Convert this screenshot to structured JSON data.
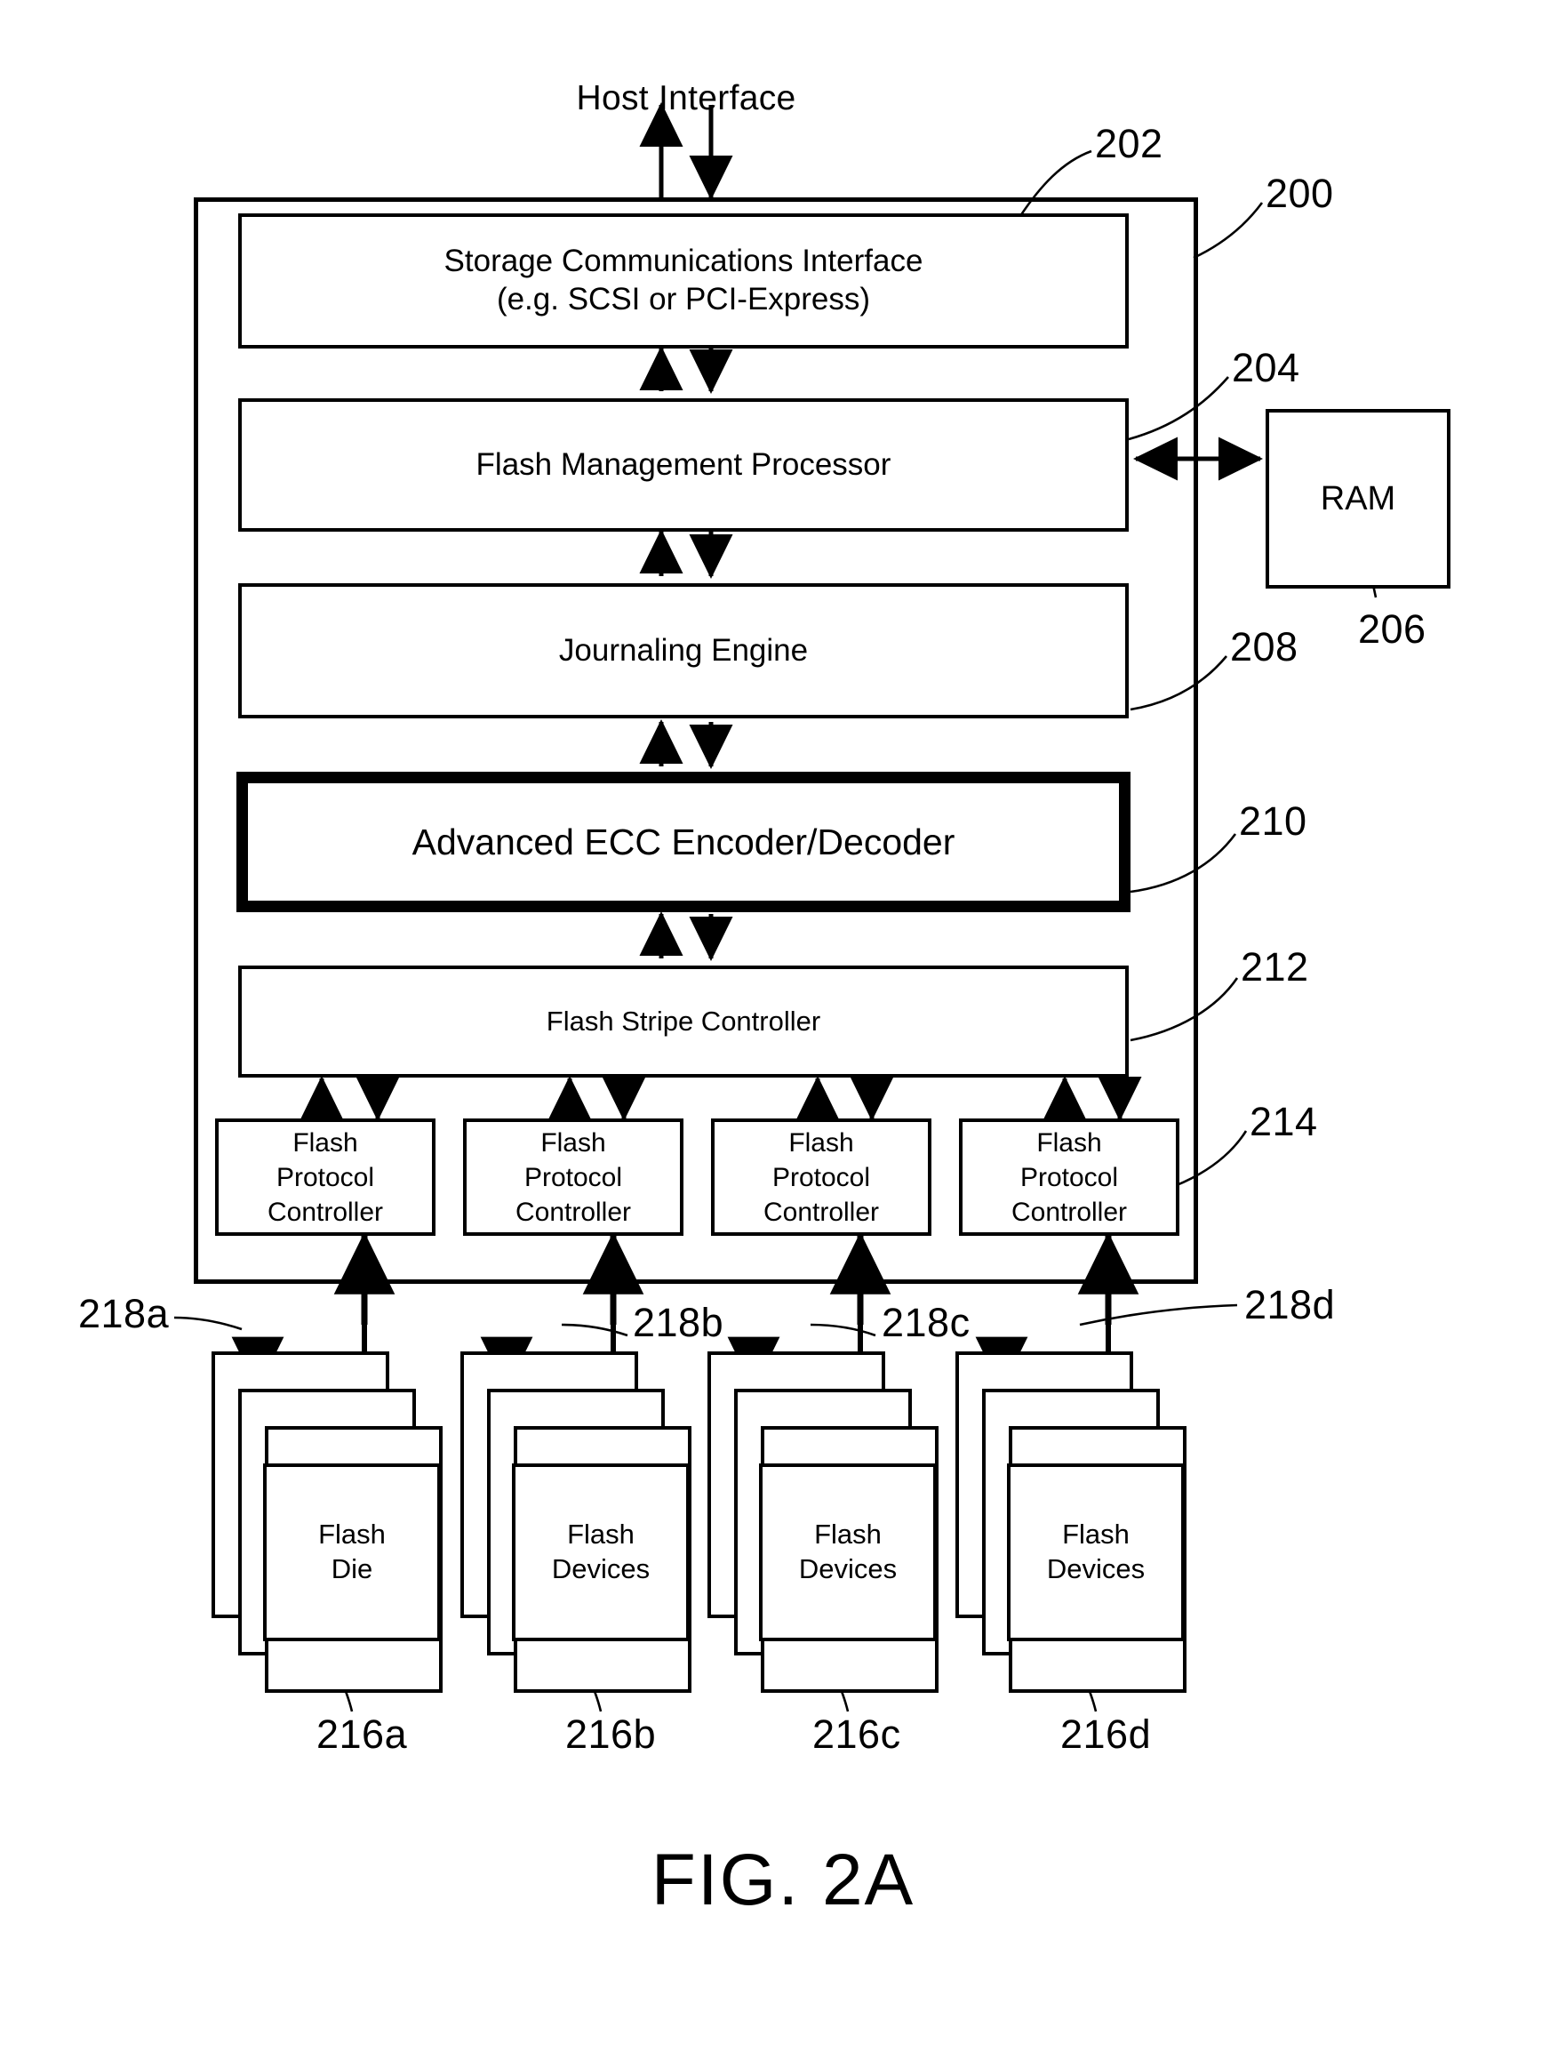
{
  "figure": {
    "label": "FIG. 2A",
    "top_label": "Host Interface"
  },
  "blocks": {
    "storage_comm": {
      "line1": "Storage Communications Interface",
      "line2": "(e.g. SCSI or PCI-Express)",
      "ref": "202"
    },
    "flash_mgmt": {
      "label": "Flash Management Processor",
      "ref": "204"
    },
    "ram": {
      "label": "RAM",
      "ref": "206"
    },
    "journaling": {
      "label": "Journaling Engine",
      "ref": "208"
    },
    "ecc": {
      "label": "Advanced ECC Encoder/Decoder",
      "ref": "210"
    },
    "stripe": {
      "label": "Flash Stripe Controller",
      "ref": "212"
    },
    "controller_assembly": {
      "ref": "200"
    },
    "protocol_controllers": {
      "ref": "214",
      "items": [
        {
          "line1": "Flash",
          "line2": "Protocol",
          "line3": "Controller"
        },
        {
          "line1": "Flash",
          "line2": "Protocol",
          "line3": "Controller"
        },
        {
          "line1": "Flash",
          "line2": "Protocol",
          "line3": "Controller"
        },
        {
          "line1": "Flash",
          "line2": "Protocol",
          "line3": "Controller"
        }
      ]
    },
    "flash_stacks": {
      "items": [
        {
          "line1": "Flash",
          "line2": "Die",
          "ref": "216a",
          "bus_ref": "218a"
        },
        {
          "line1": "Flash",
          "line2": "Devices",
          "ref": "216b",
          "bus_ref": "218b"
        },
        {
          "line1": "Flash",
          "line2": "Devices",
          "ref": "216c",
          "bus_ref": "218c"
        },
        {
          "line1": "Flash",
          "line2": "Devices",
          "ref": "216d",
          "bus_ref": "218d"
        }
      ]
    }
  },
  "colors": {
    "ink": "#000000",
    "paper": "#ffffff"
  }
}
